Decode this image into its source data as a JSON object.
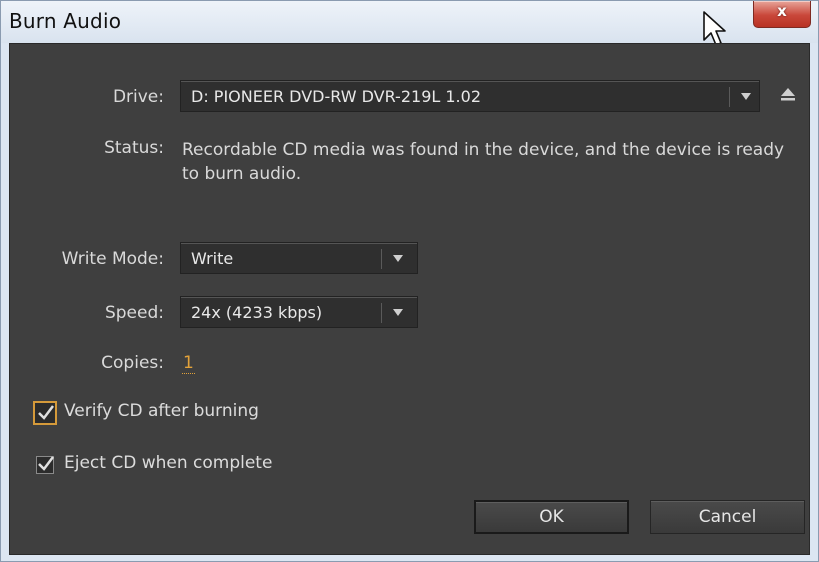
{
  "window": {
    "title": "Burn Audio",
    "close_label": "x"
  },
  "form": {
    "drive_label": "Drive:",
    "drive_value": "D: PIONEER DVD-RW  DVR-219L 1.02",
    "status_label": "Status:",
    "status_text": "Recordable CD media was found in the device, and the device is ready to burn audio.",
    "write_mode_label": "Write Mode:",
    "write_mode_value": "Write",
    "speed_label": "Speed:",
    "speed_value": "24x (4233 kbps)",
    "copies_label": "Copies:",
    "copies_value": "1"
  },
  "options": {
    "verify_label": "Verify CD after burning",
    "verify_checked": true,
    "eject_label": "Eject CD when complete",
    "eject_checked": true
  },
  "buttons": {
    "ok_label": "OK",
    "cancel_label": "Cancel"
  },
  "icons": {
    "eject": "eject-icon",
    "dropdown_arrow": "chevron-down-icon",
    "checkmark": "check-icon",
    "cursor": "mouse-pointer-icon"
  },
  "colors": {
    "dialog_bg": "#3f3f3f",
    "accent_orange": "#e2a23a",
    "close_red": "#c9473a"
  }
}
